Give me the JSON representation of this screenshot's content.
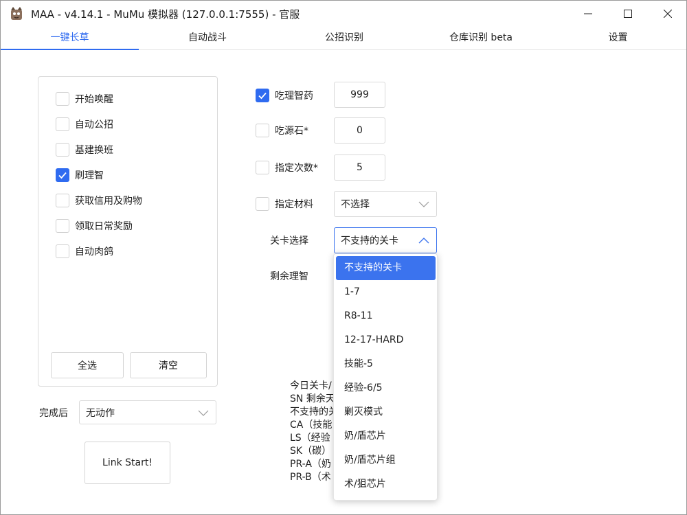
{
  "window": {
    "title": "MAA - v4.14.1 - MuMu 模拟器 (127.0.0.1:7555) - 官服",
    "controls": {
      "minimize_icon": "minimize-icon",
      "maximize_icon": "maximize-icon",
      "close_icon": "close-icon"
    }
  },
  "tabs": [
    {
      "label": "一键长草",
      "active": true
    },
    {
      "label": "自动战斗",
      "active": false
    },
    {
      "label": "公招识别",
      "active": false
    },
    {
      "label": "仓库识别 beta",
      "active": false
    },
    {
      "label": "设置",
      "active": false
    }
  ],
  "tasks": {
    "items": [
      {
        "label": "开始唤醒",
        "checked": false
      },
      {
        "label": "自动公招",
        "checked": false
      },
      {
        "label": "基建换班",
        "checked": false
      },
      {
        "label": "刷理智",
        "checked": true
      },
      {
        "label": "获取信用及购物",
        "checked": false
      },
      {
        "label": "领取日常奖励",
        "checked": false
      },
      {
        "label": "自动肉鸽",
        "checked": false
      }
    ],
    "select_all_label": "全选",
    "clear_label": "清空"
  },
  "after_completion": {
    "label": "完成后",
    "value": "无动作"
  },
  "link_start_label": "Link Start!",
  "fight": {
    "medicine": {
      "label": "吃理智药",
      "checked": true,
      "value": "999"
    },
    "stone": {
      "label": "吃源石*",
      "checked": false,
      "value": "0"
    },
    "times": {
      "label": "指定次数*",
      "checked": false,
      "value": "5"
    },
    "material": {
      "label": "指定材料",
      "checked": false,
      "value": "不选择"
    },
    "stage": {
      "label": "关卡选择",
      "value": "不支持的关卡"
    },
    "remaining_label": "剩余理智"
  },
  "stage_dropdown": {
    "options": [
      "不支持的关卡",
      "1-7",
      "R8-11",
      "12-17-HARD",
      "技能-5",
      "经验-6/5",
      "剿灭模式",
      "奶/盾芯片",
      "奶/盾芯片组",
      "术/狙芯片"
    ],
    "selected_index": 0
  },
  "info_lines": [
    "今日关卡/",
    "SN 剩余天",
    "不支持的关",
    "CA（技能",
    "LS（经验",
    "SK（碳）",
    "PR-A（奶",
    "PR-B（术"
  ],
  "colors": {
    "accent": "#2f6bf0",
    "selected_bg": "#3b73ee"
  }
}
